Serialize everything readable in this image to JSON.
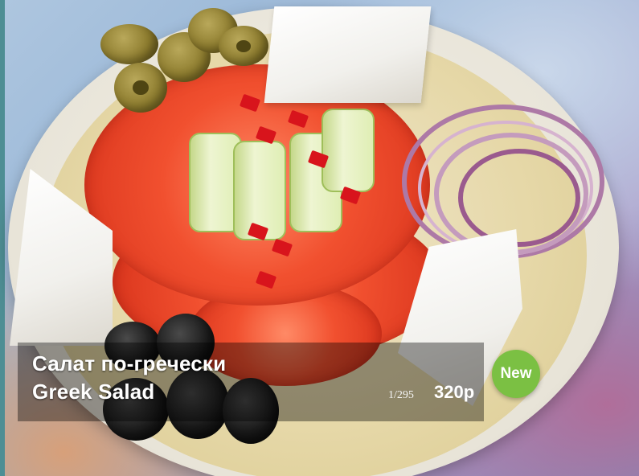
{
  "dish": {
    "name_ru": "Салат по-гречески",
    "name_en": "Greek Salad",
    "weight_label": "1/295",
    "price_label": "320р"
  },
  "badge": {
    "label": "New",
    "color": "#7bc043"
  },
  "photo": {
    "icon": "food-photo"
  }
}
